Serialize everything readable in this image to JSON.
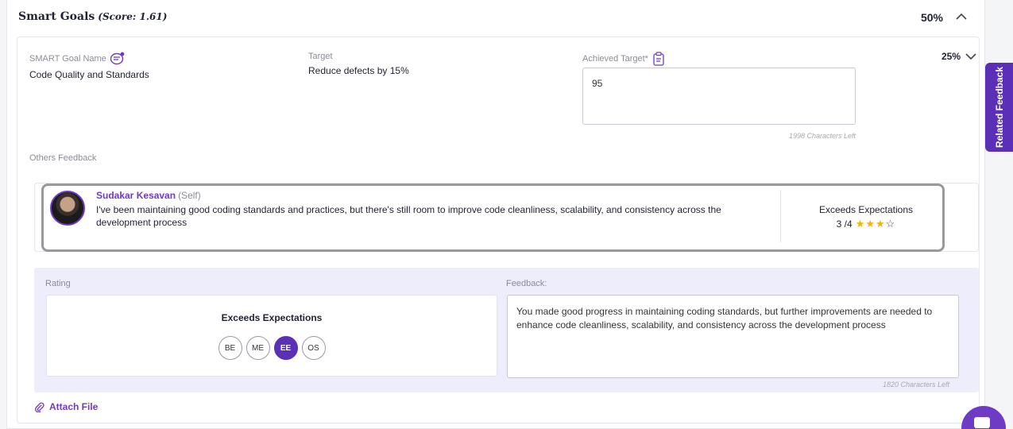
{
  "section": {
    "title": "Smart Goals",
    "score": "(Score: 1.61)",
    "percent": "50%"
  },
  "goal": {
    "name_label": "SMART Goal Name",
    "name": "Code Quality and Standards",
    "target_label": "Target",
    "target": "Reduce defects by 15%",
    "achieved_label": "Achieved Target*",
    "achieved_value": "95",
    "achieved_chars_left": "1998 Characters Left",
    "percent": "25%"
  },
  "others_feedback": {
    "label": "Others Feedback",
    "reviewer_name": "Sudakar Kesavan",
    "reviewer_role": "(Self)",
    "text": "I've been maintaining good coding standards and practices, but there's still room to improve code cleanliness, scalability, and consistency across the development process",
    "rating_label": "Exceeds Expectations",
    "rating_score": "3 /4",
    "stars_filled": 3,
    "stars_total": 4
  },
  "evaluation": {
    "rating_label": "Rating",
    "selected_rating": "Exceeds Expectations",
    "options": [
      "BE",
      "ME",
      "EE",
      "OS"
    ],
    "selected_option": "EE",
    "feedback_label": "Feedback:",
    "feedback_text": "You made good progress in maintaining coding standards, but further improvements are needed to enhance code cleanliness, scalability, and consistency across the development process",
    "feedback_chars_left": "1820 Characters Left"
  },
  "attach_label": "Attach File",
  "related_feedback_label": "Related Feedback",
  "colors": {
    "accent": "#5b2fb8",
    "accent_text": "#6e3bc4",
    "star": "#f5b301",
    "panel_bg": "#eeedfb"
  },
  "icons": {
    "section_toggle": "chevron-up-icon",
    "goal_toggle": "chevron-down-icon",
    "goal_name": "chat-icon",
    "achieved": "clipboard-icon",
    "attach": "paperclip-icon",
    "chat_fab": "chat-bubble-icon"
  }
}
